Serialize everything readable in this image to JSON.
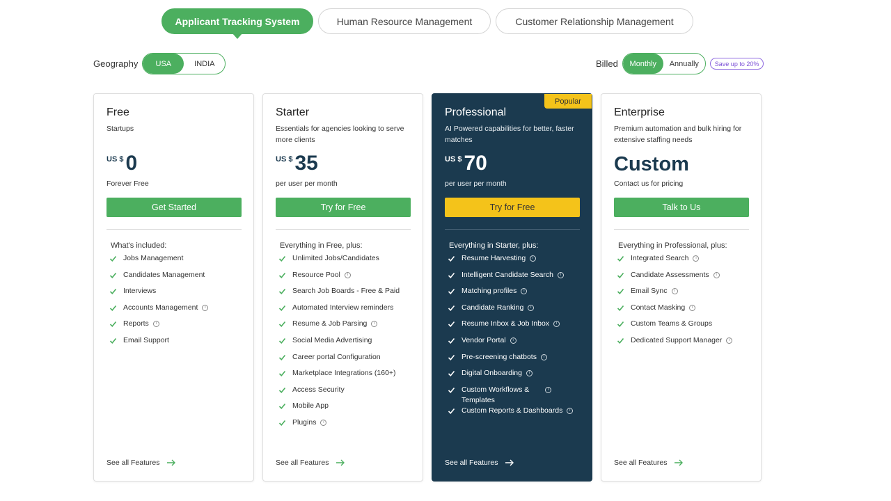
{
  "tabs": [
    {
      "label": "Applicant Tracking System",
      "active": true
    },
    {
      "label": "Human Resource Management",
      "active": false
    },
    {
      "label": "Customer Relationship Management",
      "active": false
    }
  ],
  "geography": {
    "label": "Geography",
    "options": [
      "USA",
      "INDIA"
    ],
    "selected": "USA"
  },
  "billing": {
    "label": "Billed",
    "options": [
      "Monthly",
      "Annually"
    ],
    "selected": "Monthly",
    "save_badge": "Save up to 20%"
  },
  "colors": {
    "accent": "#4caf5f",
    "featured_bg": "#1b3a4f",
    "highlight": "#f4c31a",
    "badge_purple": "#7b4fd6"
  },
  "plans": [
    {
      "name": "Free",
      "description": "Startups",
      "currency": "US $",
      "price": "0",
      "price_sub": "Forever Free",
      "cta": "Get Started",
      "included_title": "What's included:",
      "features": [
        {
          "text": "Jobs Management",
          "info": false
        },
        {
          "text": "Candidates Management",
          "info": false
        },
        {
          "text": "Interviews",
          "info": false
        },
        {
          "text": "Accounts Management",
          "info": true
        },
        {
          "text": "Reports",
          "info": true
        },
        {
          "text": "Email Support",
          "info": false
        }
      ],
      "see_all": "See all Features"
    },
    {
      "name": "Starter",
      "description": "Essentials for agencies looking to serve more clients",
      "currency": "US $",
      "price": "35",
      "price_sub": "per user per month",
      "cta": "Try for Free",
      "included_title": "Everything in Free, plus:",
      "features": [
        {
          "text": "Unlimited Jobs/Candidates",
          "info": false
        },
        {
          "text": "Resource Pool",
          "info": true
        },
        {
          "text": "Search Job Boards - Free & Paid",
          "info": false
        },
        {
          "text": "Automated Interview reminders",
          "info": false
        },
        {
          "text": "Resume & Job Parsing",
          "info": true
        },
        {
          "text": "Social Media Advertising",
          "info": false
        },
        {
          "text": "Career portal Configuration",
          "info": false
        },
        {
          "text": "Marketplace Integrations (160+)",
          "info": false
        },
        {
          "text": "Access Security",
          "info": false
        },
        {
          "text": "Mobile App",
          "info": false
        },
        {
          "text": "Plugins",
          "info": true
        }
      ],
      "see_all": "See all Features"
    },
    {
      "name": "Professional",
      "badge": "Popular",
      "description": "AI Powered capabilities for better, faster matches",
      "currency": "US $",
      "price": "70",
      "price_sub": "per user per month",
      "cta": "Try for Free",
      "included_title": "Everything in Starter, plus:",
      "features": [
        {
          "text": "Resume Harvesting",
          "info": true
        },
        {
          "text": "Intelligent Candidate Search",
          "info": true
        },
        {
          "text": "Matching profiles",
          "info": true
        },
        {
          "text": "Candidate Ranking",
          "info": true
        },
        {
          "text": "Resume Inbox & Job Inbox",
          "info": true
        },
        {
          "text": "Vendor Portal",
          "info": true
        },
        {
          "text": "Pre-screening chatbots",
          "info": true
        },
        {
          "text": "Digital Onboarding",
          "info": true
        },
        {
          "text": "Custom Workflows & Templates",
          "info": true,
          "wrap": true
        },
        {
          "text": "Custom Reports & Dashboards",
          "info": true
        }
      ],
      "see_all": "See all Features"
    },
    {
      "name": "Enterprise",
      "description": "Premium automation and bulk hiring for extensive staffing needs",
      "price_custom": "Custom",
      "price_sub": "Contact us for pricing",
      "cta": "Talk to Us",
      "included_title": "Everything in Professional, plus:",
      "features": [
        {
          "text": "Integrated Search",
          "info": true
        },
        {
          "text": "Candidate Assessments",
          "info": true
        },
        {
          "text": "Email Sync",
          "info": true
        },
        {
          "text": "Contact Masking",
          "info": true
        },
        {
          "text": "Custom Teams & Groups",
          "info": false
        },
        {
          "text": "Dedicated Support Manager",
          "info": true
        }
      ],
      "see_all": "See all Features"
    }
  ]
}
